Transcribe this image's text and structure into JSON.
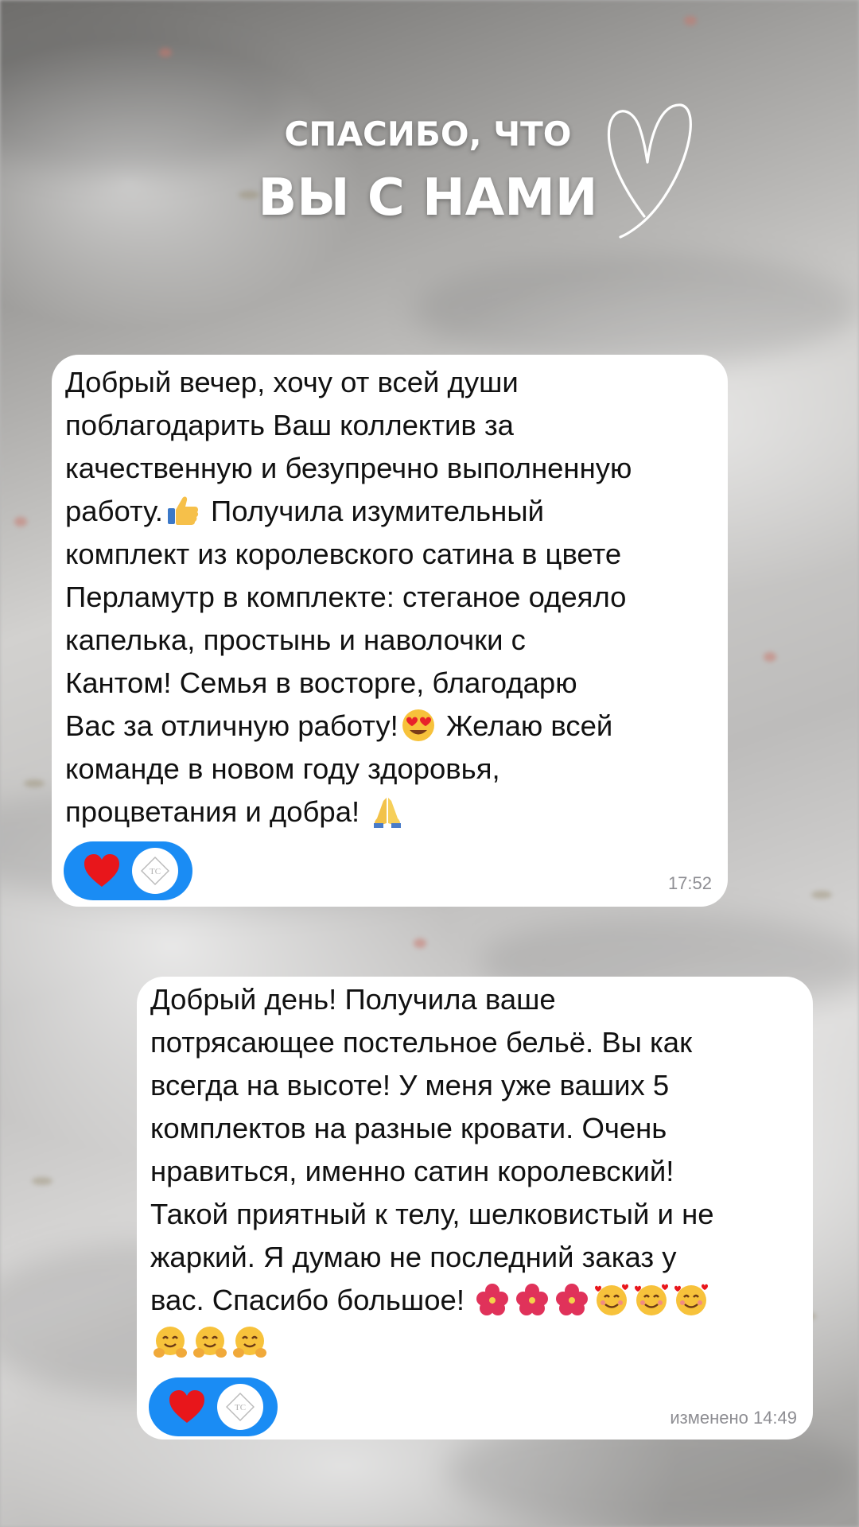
{
  "header": {
    "line1": "СПАСИБО, ЧТО",
    "line2": "ВЫ С НАМИ"
  },
  "messages": [
    {
      "text_a": "Добрый вечер, хочу от всей души\nпоблагодарить Ваш коллектив за\nкачественную и безупречно выполненную\nработу.",
      "emoji_a": "thumbs-up",
      "text_b": " Получила изумительный\nкомплект из королевского сатина в цвете\nПерламутр в комплекте: стеганое одеяло\nкапелька, простынь и наволочки с\nКантом!  Семья в восторге, благодарю\nВас за отличную работу!",
      "emoji_b": "heart-eyes",
      "text_c": " Желаю всей\nкоманде в новом году здоровья,\nпроцветания и добра! ",
      "emoji_c": "folded-hands",
      "time": "17:52",
      "reaction": "heart-icon"
    },
    {
      "text_a": "Добрый день! Получила ваше\nпотрясающее постельное бельё. Вы как\nвсегда на высоте! У меня уже  ваших 5\nкомплектов на разные кровати. Очень\nнравиться, именно сатин королевский!\nТакой приятный к телу, шелковистый и не\nжаркий. Я думаю не последний заказ у\nвас.  Спасибо большое! ",
      "emojis_row1": [
        "hibiscus",
        "hibiscus",
        "hibiscus",
        "smiling-hearts",
        "smiling-hearts",
        "smiling-hearts"
      ],
      "emojis_row2": [
        "hugging",
        "hugging",
        "hugging"
      ],
      "time": "изменено 14:49",
      "reaction": "heart-icon"
    }
  ],
  "colors": {
    "reaction_pill": "#1a8cf4",
    "heart": "#e8161b",
    "bubble": "#ffffff",
    "timestamp": "#8e8e93"
  }
}
